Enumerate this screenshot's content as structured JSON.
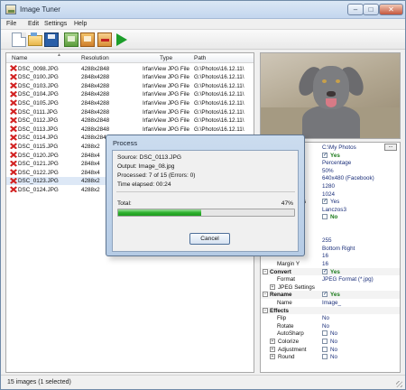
{
  "window": {
    "title": "Image Tuner"
  },
  "menu": [
    "File",
    "Edit",
    "Settings",
    "Help"
  ],
  "toolbar": [
    {
      "icon": "new-file-icon"
    },
    {
      "icon": "open-folder-icon"
    },
    {
      "icon": "save-icon"
    },
    {
      "icon": "add-folder-icon"
    },
    {
      "icon": "add-images-icon"
    },
    {
      "icon": "remove-images-icon"
    },
    {
      "icon": "run-icon"
    }
  ],
  "list": {
    "columns": [
      "Name",
      "Resolution",
      "Type",
      "Path"
    ],
    "rows": [
      {
        "name": "DSC_0098.JPG",
        "resolution": "4288x2848",
        "type": "IrfanView JPG File",
        "path": "G:\\Photos\\16.12.11\\",
        "selected": false
      },
      {
        "name": "DSC_0100.JPG",
        "resolution": "2848x4288",
        "type": "IrfanView JPG File",
        "path": "G:\\Photos\\16.12.11\\",
        "selected": false
      },
      {
        "name": "DSC_0103.JPG",
        "resolution": "2848x4288",
        "type": "IrfanView JPG File",
        "path": "G:\\Photos\\16.12.11\\",
        "selected": false
      },
      {
        "name": "DSC_0104.JPG",
        "resolution": "2848x4288",
        "type": "IrfanView JPG File",
        "path": "G:\\Photos\\16.12.11\\",
        "selected": false
      },
      {
        "name": "DSC_0105.JPG",
        "resolution": "2848x4288",
        "type": "IrfanView JPG File",
        "path": "G:\\Photos\\16.12.11\\",
        "selected": false
      },
      {
        "name": "DSC_0111.JPG",
        "resolution": "2848x4288",
        "type": "IrfanView JPG File",
        "path": "G:\\Photos\\16.12.11\\",
        "selected": false
      },
      {
        "name": "DSC_0112.JPG",
        "resolution": "4288x2848",
        "type": "IrfanView JPG File",
        "path": "G:\\Photos\\16.12.11\\",
        "selected": false
      },
      {
        "name": "DSC_0113.JPG",
        "resolution": "4288x2848",
        "type": "IrfanView JPG File",
        "path": "G:\\Photos\\16.12.11\\",
        "selected": false
      },
      {
        "name": "DSC_0114.JPG",
        "resolution": "4288x2848",
        "type": "IrfanView JPG File",
        "path": "G:\\Photos\\16.12.11\\",
        "selected": false
      },
      {
        "name": "DSC_0115.JPG",
        "resolution": "4288x2",
        "type": "",
        "path": "",
        "selected": false
      },
      {
        "name": "DSC_0120.JPG",
        "resolution": "2848x4",
        "type": "",
        "path": "",
        "selected": false
      },
      {
        "name": "DSC_0121.JPG",
        "resolution": "2848x4",
        "type": "",
        "path": "",
        "selected": false
      },
      {
        "name": "DSC_0122.JPG",
        "resolution": "2848x4",
        "type": "",
        "path": "",
        "selected": false
      },
      {
        "name": "DSC_0123.JPG",
        "resolution": "4288x2",
        "type": "",
        "path": "",
        "selected": true
      },
      {
        "name": "DSC_0124.JPG",
        "resolution": "4288x2",
        "type": "",
        "path": "",
        "selected": false
      }
    ]
  },
  "preview": {
    "image": "dog-photo"
  },
  "properties": [
    {
      "kind": "value",
      "label": "",
      "value": "C:\\My Photos",
      "browse": "..."
    },
    {
      "kind": "check",
      "label": "",
      "checked": true,
      "text": "Yes",
      "bold": true
    },
    {
      "kind": "value",
      "label": "",
      "value": "Percentage"
    },
    {
      "kind": "value",
      "label": "",
      "value": "50%"
    },
    {
      "kind": "value",
      "label": "",
      "value": "640x480 (Facebook)"
    },
    {
      "kind": "value",
      "label": "Width",
      "value": "1280"
    },
    {
      "kind": "value",
      "label": "Height",
      "value": "1024"
    },
    {
      "kind": "check",
      "label": "Proportions",
      "checked": true,
      "text": "Yes",
      "bold": false
    },
    {
      "kind": "value",
      "label": "",
      "value": "Lanczos3"
    },
    {
      "kind": "check",
      "label": "",
      "checked": false,
      "text": "No",
      "bold": true
    },
    {
      "kind": "value",
      "label": "",
      "value": ""
    },
    {
      "kind": "value",
      "label": "",
      "value": ""
    },
    {
      "kind": "value",
      "label": "",
      "value": "255"
    },
    {
      "kind": "value",
      "label": "",
      "value": "Bottom Right"
    },
    {
      "kind": "value",
      "label": "",
      "value": "16"
    },
    {
      "kind": "value",
      "label": "Margin Y",
      "value": "16"
    },
    {
      "kind": "section-check",
      "label": "Convert",
      "toggle": "−",
      "checked": true,
      "text": "Yes"
    },
    {
      "kind": "value",
      "label": "Format",
      "value": "JPEG Format (*.jpg)"
    },
    {
      "kind": "sub",
      "label": "JPEG Settings",
      "toggle": "+"
    },
    {
      "kind": "section-check",
      "label": "Rename",
      "toggle": "−",
      "checked": true,
      "text": "Yes"
    },
    {
      "kind": "value",
      "label": "Name",
      "value": "Image_"
    },
    {
      "kind": "section",
      "label": "Effects",
      "toggle": "−"
    },
    {
      "kind": "value",
      "label": "Flip",
      "value": "No"
    },
    {
      "kind": "value",
      "label": "Rotate",
      "value": "No"
    },
    {
      "kind": "check",
      "label": "AutoSharp",
      "checked": false,
      "text": "No",
      "bold": false
    },
    {
      "kind": "sub-check",
      "label": "Colorize",
      "toggle": "+",
      "checked": false,
      "text": "No"
    },
    {
      "kind": "sub-check",
      "label": "Adjustment",
      "toggle": "+",
      "checked": false,
      "text": "No"
    },
    {
      "kind": "sub-check",
      "label": "Round",
      "toggle": "+",
      "checked": false,
      "text": "No"
    }
  ],
  "status": {
    "text": "15 images (1 selected)"
  },
  "dialog": {
    "title": "Process",
    "source": "Source: DSC_0113.JPG",
    "output": "Output: Image_08.jpg",
    "processed": "Processed: 7 of 15 (Errors: 0)",
    "elapsed": "Time elapsed: 00:24",
    "total_label": "Total:",
    "percent_text": "47%",
    "progress": 0.47,
    "cancel_label": "Cancel"
  }
}
